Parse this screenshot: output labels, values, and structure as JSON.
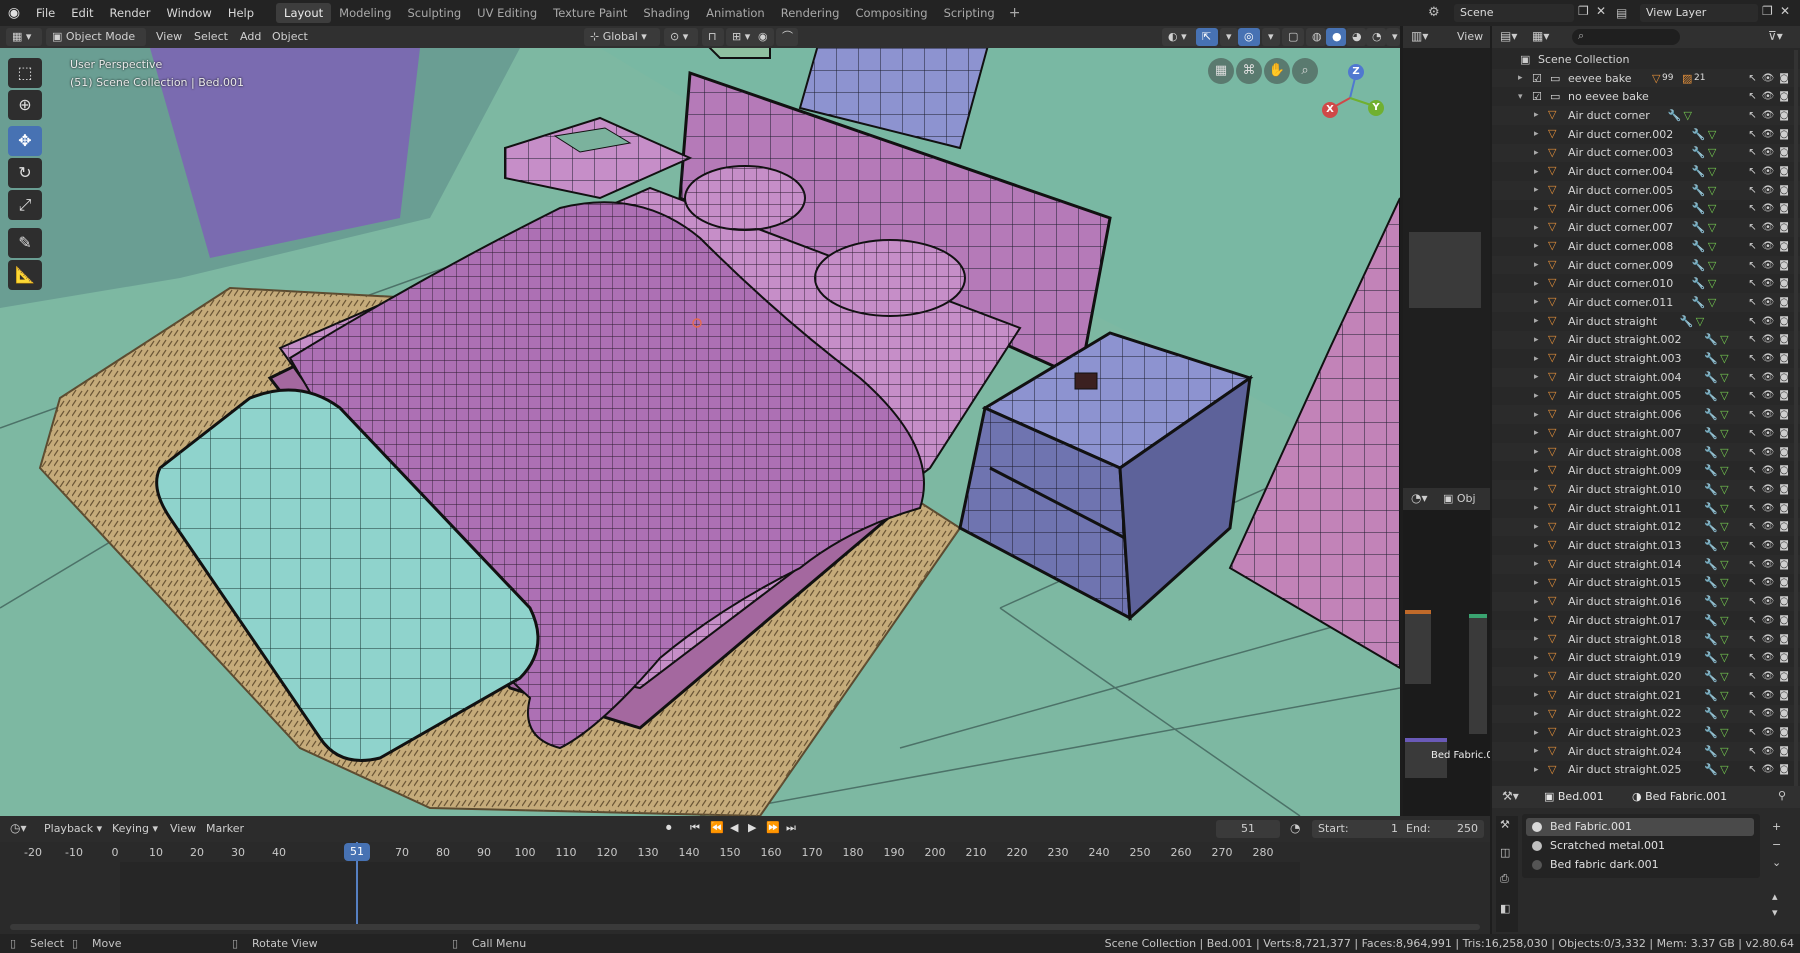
{
  "topbar": {
    "menu": [
      "File",
      "Edit",
      "Render",
      "Window",
      "Help"
    ],
    "workspaces": [
      "Layout",
      "Modeling",
      "Sculpting",
      "UV Editing",
      "Texture Paint",
      "Shading",
      "Animation",
      "Rendering",
      "Compositing",
      "Scripting"
    ],
    "active_workspace": "Layout",
    "add_workspace": "+",
    "scene": "Scene",
    "view_layer": "View Layer"
  },
  "viewport_header": {
    "mode": "Object Mode",
    "menus": [
      "View",
      "Select",
      "Add",
      "Object"
    ],
    "transform_orientation": "Global"
  },
  "viewport": {
    "perspective_label": "User Perspective",
    "collection_label": "(51) Scene Collection | Bed.001",
    "gizmo_axes": {
      "x": "X",
      "y": "Y",
      "z": "Z"
    }
  },
  "mid_panel": {
    "view_label": "View",
    "obj_label": "Obj",
    "node_label": "Bed Fabric.0"
  },
  "outliner": {
    "root": "Scene Collection",
    "collections": [
      {
        "name": "eevee bake",
        "badge1": "99",
        "badge2": "21"
      },
      {
        "name": "no eevee bake"
      }
    ],
    "objects": [
      "Air duct corner",
      "Air duct corner.002",
      "Air duct corner.003",
      "Air duct corner.004",
      "Air duct corner.005",
      "Air duct corner.006",
      "Air duct corner.007",
      "Air duct corner.008",
      "Air duct corner.009",
      "Air duct corner.010",
      "Air duct corner.011",
      "Air duct straight",
      "Air duct straight.002",
      "Air duct straight.003",
      "Air duct straight.004",
      "Air duct straight.005",
      "Air duct straight.006",
      "Air duct straight.007",
      "Air duct straight.008",
      "Air duct straight.009",
      "Air duct straight.010",
      "Air duct straight.011",
      "Air duct straight.012",
      "Air duct straight.013",
      "Air duct straight.014",
      "Air duct straight.015",
      "Air duct straight.016",
      "Air duct straight.017",
      "Air duct straight.018",
      "Air duct straight.019",
      "Air duct straight.020",
      "Air duct straight.021",
      "Air duct straight.022",
      "Air duct straight.023",
      "Air duct straight.024",
      "Air duct straight.025"
    ]
  },
  "timeline": {
    "menus": [
      "Playback",
      "Keying",
      "View",
      "Marker"
    ],
    "current_frame": "51",
    "start_label": "Start:",
    "start": "1",
    "end_label": "End:",
    "end": "250",
    "ticks": [
      "-20",
      "-10",
      "0",
      "10",
      "20",
      "30",
      "40",
      "50",
      "60",
      "70",
      "80",
      "90",
      "100",
      "110",
      "120",
      "130",
      "140",
      "150",
      "160",
      "170",
      "180",
      "190",
      "200",
      "210",
      "220",
      "230",
      "240",
      "250",
      "260",
      "270",
      "280"
    ],
    "playhead_label": "51"
  },
  "properties": {
    "object": "Bed.001",
    "material": "Bed Fabric.001",
    "slots": [
      "Bed Fabric.001",
      "Scratched metal.001",
      "Bed fabric dark.001"
    ],
    "colors": [
      "#d9d9d9",
      "#bfbfbf",
      "#555555"
    ]
  },
  "status": {
    "select": "Select",
    "move": "Move",
    "rotate": "Rotate View",
    "menu": "Call Menu",
    "stats": "Scene Collection | Bed.001 | Verts:8,721,377 | Faces:8,964,991 | Tris:16,258,030 | Objects:0/3,332 | Mem: 3.37 GB | v2.80.64"
  },
  "colors": {
    "accent": "#4772b3",
    "viewport_floor": "#7db8a2",
    "bed_pink": "#b57ab8",
    "bench_cyan": "#8fd3cc",
    "nightstand_blue": "#8d93d0",
    "rug": "#c5ab7a",
    "wall_purple": "#7a6bb0"
  }
}
